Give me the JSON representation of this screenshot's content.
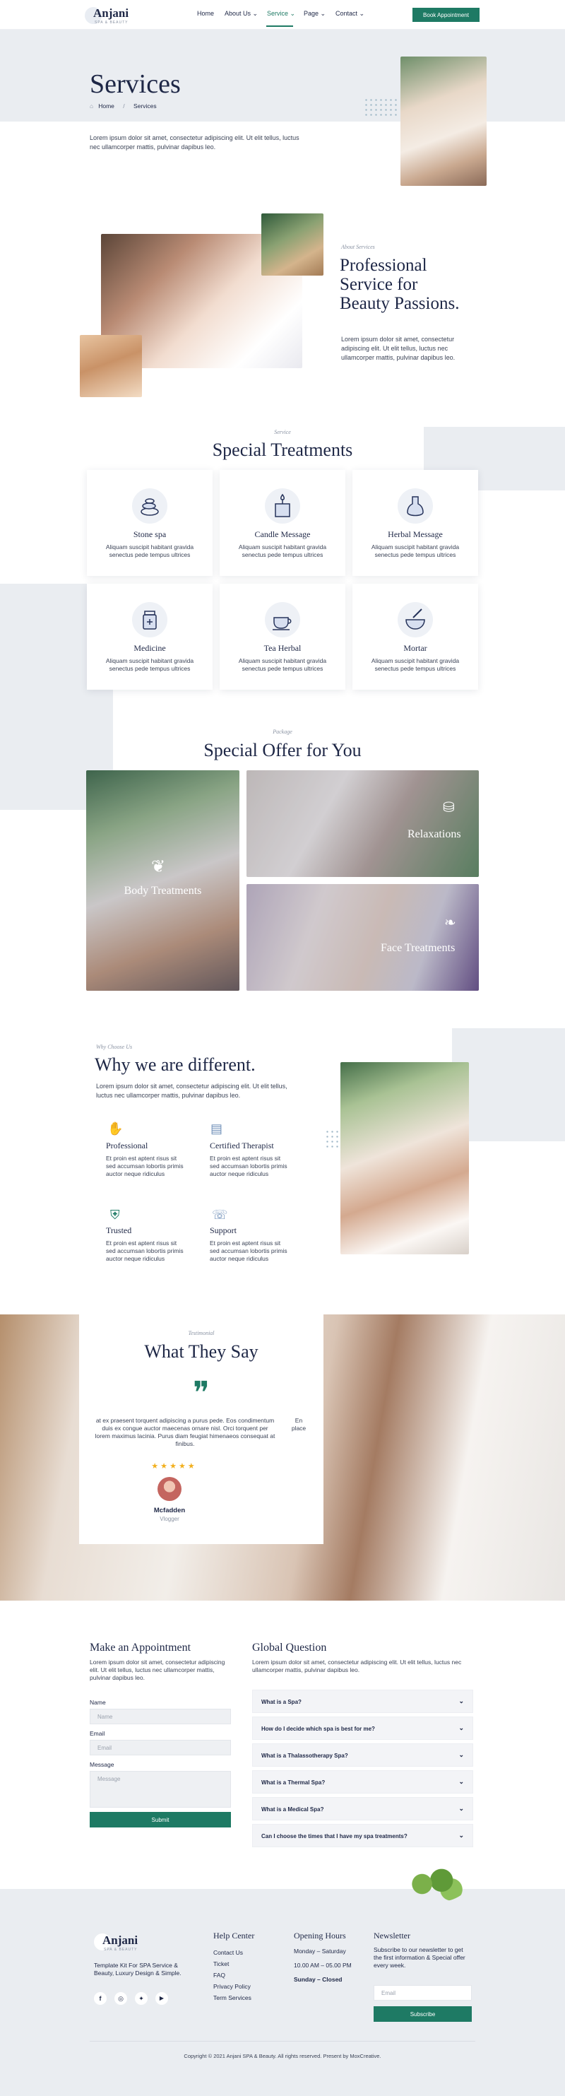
{
  "header": {
    "logo_text": "Anjani",
    "logo_sub": "SPA & BEAUTY",
    "nav": [
      {
        "label": "Home"
      },
      {
        "label": "About Us ⌄"
      },
      {
        "label": "Service ⌄"
      },
      {
        "label": "Page ⌄"
      },
      {
        "label": "Contact ⌄"
      }
    ],
    "cta": "Book Appointment"
  },
  "banner": {
    "title": "Services",
    "crumb_home": "Home",
    "crumb_sep": "/",
    "crumb_current": "Services",
    "intro": "Lorem ipsum dolor sit amet, consectetur adipiscing elit. Ut elit tellus, luctus nec ullamcorper mattis, pulvinar dapibus leo."
  },
  "about": {
    "label": "About Services",
    "title": "Professional Service for Beauty Passions.",
    "text": "Lorem ipsum dolor sit amet, consectetur adipiscing elit. Ut elit tellus, luctus nec ullamcorper mattis, pulvinar dapibus leo."
  },
  "treatments": {
    "label": "Service",
    "title": "Special Treatments",
    "items": [
      {
        "title": "Stone spa",
        "desc": "Aliquam suscipit habitant gravida senectus pede tempus ultrices",
        "icon": "stones-icon"
      },
      {
        "title": "Candle Message",
        "desc": "Aliquam suscipit habitant gravida senectus pede tempus ultrices",
        "icon": "candle-icon"
      },
      {
        "title": "Herbal Message",
        "desc": "Aliquam suscipit habitant gravida senectus pede tempus ultrices",
        "icon": "herbal-bottle-icon"
      },
      {
        "title": "Medicine",
        "desc": "Aliquam suscipit habitant gravida senectus pede tempus ultrices",
        "icon": "medicine-jar-icon"
      },
      {
        "title": "Tea Herbal",
        "desc": "Aliquam suscipit habitant gravida senectus pede tempus ultrices",
        "icon": "tea-cup-icon"
      },
      {
        "title": "Mortar",
        "desc": "Aliquam suscipit habitant gravida senectus pede tempus ultrices",
        "icon": "mortar-icon"
      }
    ]
  },
  "offer": {
    "label": "Package",
    "title": "Special Offer for You",
    "items": [
      {
        "title": "Body Treatments"
      },
      {
        "title": "Relaxations"
      },
      {
        "title": "Face Treatments"
      }
    ]
  },
  "why": {
    "label": "Why Choose Us",
    "title": "Why we are different.",
    "text": "Lorem ipsum dolor sit amet, consectetur adipiscing elit. Ut elit tellus, luctus nec ullamcorper mattis, pulvinar dapibus leo.",
    "features": [
      {
        "title": "Professional",
        "desc": "Et proin est aptent risus sit sed accumsan lobortis primis auctor neque ridiculus"
      },
      {
        "title": "Certified Therapist",
        "desc": "Et proin est aptent risus sit sed accumsan lobortis primis auctor neque ridiculus"
      },
      {
        "title": "Trusted",
        "desc": "Et proin est aptent risus sit sed accumsan lobortis primis auctor neque ridiculus"
      },
      {
        "title": "Support",
        "desc": "Et proin est aptent risus sit sed accumsan lobortis primis auctor neque ridiculus"
      }
    ]
  },
  "testimonial": {
    "label": "Testimonial",
    "title": "What They Say",
    "quote_mark": "❞",
    "quote": "at ex praesent torquent adipiscing a purus pede. Eos condimentum duis ex congue auctor maecenas ornare nisl. Orci torquent per lorem maximus lacinia. Purus diam feugiat himenaeos consequat at finibus.",
    "next_peek": "En place",
    "stars": "★ ★ ★ ★ ★",
    "name": "Mcfadden",
    "role": "Vlogger"
  },
  "appointment": {
    "title": "Make an Appointment",
    "text": "Lorem ipsum dolor sit amet, consectetur adipiscing elit. Ut elit tellus, luctus nec ullamcorper mattis, pulvinar dapibus leo.",
    "name_label": "Name",
    "name_placeholder": "Name",
    "email_label": "Email",
    "email_placeholder": "Email",
    "message_label": "Message",
    "message_placeholder": "Message",
    "submit": "Submit"
  },
  "faq": {
    "title": "Global Question",
    "text": "Lorem ipsum dolor sit amet, consectetur adipiscing elit. Ut elit tellus, luctus nec ullamcorper mattis, pulvinar dapibus leo.",
    "items": [
      "What is a Spa?",
      "How do I decide which spa is best for me?",
      "What is a Thalassotherapy Spa?",
      "What is a Thermal Spa?",
      "What is a Medical Spa?",
      "Can I choose the times that I have my spa treatments?"
    ]
  },
  "footer": {
    "logo_text": "Anjani",
    "logo_sub": "SPA & BEAUTY",
    "tagline": "Template Kit For SPA Service & Beauty, Luxury Design & Simple.",
    "help_title": "Help Center",
    "help_links": [
      "Contact Us",
      "Ticket",
      "FAQ",
      "Privacy Policy",
      "Term Services"
    ],
    "hours_title": "Opening Hours",
    "hours": [
      "Monday – Saturday",
      "10.00 AM – 05.00 PM",
      "Sunday – Closed"
    ],
    "news_title": "Newsletter",
    "news_text": "Subscribe to our newsletter to get the first information & Special offer every week.",
    "email_placeholder": "Email",
    "subscribe": "Subscribe",
    "copyright": "Copyright © 2021 Anjani SPA & Beauty. All rights reserved. Present by MoxCreative."
  },
  "colors": {
    "accent": "#1e7a64",
    "navy": "#1e2746",
    "banner_bg": "#eaedf1",
    "star": "#f2b01e"
  }
}
